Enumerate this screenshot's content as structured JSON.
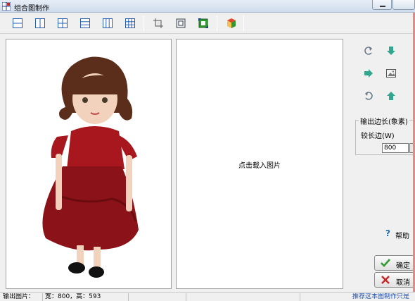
{
  "window": {
    "title": "组合图制作"
  },
  "toolbar": {
    "layout_icons": [
      "layout-two-rows-icon",
      "layout-two-columns-icon",
      "layout-2x2-icon",
      "layout-three-rows-icon",
      "layout-three-columns-icon",
      "layout-3x3-icon"
    ],
    "tool_icons": [
      "crop-icon",
      "fit-icon",
      "resize-icon",
      "color-icon"
    ]
  },
  "canvas": {
    "right_panel_prompt": "点击载入图片"
  },
  "side": {
    "group_title": "输出边长(象素)",
    "long_side_label": "较长边(W)",
    "long_side_value": "800",
    "help_label": "帮助",
    "ok_label": "确定",
    "cancel_label": "取消"
  },
  "status": {
    "output_label": "输出图片：",
    "size_text": "宽：800，高：593",
    "right_text": "推荐这本图制作只是"
  },
  "colors": {
    "accent": "#1f6fb2",
    "ok_green": "#2e9a2e",
    "cancel_red": "#c62828"
  }
}
